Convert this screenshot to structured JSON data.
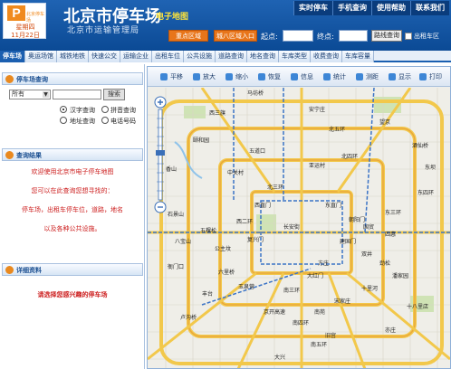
{
  "header": {
    "logo_text": "P",
    "logo_sub": "北京停车场",
    "weekday": "星期四",
    "date": "11月22日",
    "title": "北京市停车场",
    "title_badge": "电子地图",
    "subtitle": "北京市运输管理局",
    "top_nav": [
      "实时停车",
      "手机查询",
      "使用帮助",
      "联系我们"
    ],
    "center_area_btn": "重点区域",
    "city_entry_btn": "城八区域入口",
    "start_label": "起点:",
    "end_label": "终点:",
    "route_btn": "路线查询",
    "show_parking_label": "出租车区"
  },
  "tabs": [
    "停车场",
    "奥运场馆",
    "城铁地铁",
    "快速公交",
    "运输企业",
    "出租车位",
    "公共设施",
    "道路查询",
    "地名查询",
    "车库类型",
    "收费查询",
    "车库容量"
  ],
  "active_tab": 0,
  "left": {
    "search_header": "停车场查询",
    "select_value": "所有",
    "search_btn": "搜索",
    "radio1": "汉字查询",
    "radio2": "拼音查询",
    "radio3": "地址查询",
    "radio4": "电话号码",
    "result_header": "查询结果",
    "welcome_lines": [
      "欢迎使用北京市电子停车地图",
      "您可以在此查询您想寻找的：",
      "停车场，出租车停车位，道路，地名",
      "以及各种公共设施。"
    ],
    "detail_header": "详细资料",
    "detail_msg": "请选择您感兴趣的停车场"
  },
  "map": {
    "tools": [
      "平移",
      "放大",
      "缩小",
      "恢复",
      "信息",
      "统计",
      "测距",
      "显示",
      "打印"
    ],
    "labels": [
      "马坊桥",
      "西三旗",
      "安宁庄",
      "北五环",
      "亚运村",
      "北四环",
      "中关村",
      "五道口",
      "北三环",
      "西直门",
      "东直门",
      "朝阳门",
      "复兴门",
      "建国门",
      "长安街",
      "西二环",
      "东三环",
      "东四环",
      "南三环",
      "南四环",
      "丰台",
      "京开高速",
      "南五环",
      "大兴",
      "望京",
      "酒仙桥",
      "东坝",
      "石景山",
      "八宝山",
      "五棵松",
      "公主坟",
      "六里桥",
      "玉泉营",
      "宋家庄",
      "十里河",
      "大红门",
      "方庄",
      "亦庄",
      "四惠",
      "国贸",
      "双井",
      "劲松",
      "潘家园",
      "十八里店",
      "旧宫",
      "南苑",
      "卢沟桥",
      "衙门口",
      "香山",
      "颐和园"
    ]
  },
  "colors": {
    "header_blue": "#1a5aa8",
    "accent_orange": "#e8751a",
    "tab_active": "#1b5fb0",
    "road_yellow": "#f2c84b",
    "road_orange": "#e9a33a",
    "metro_blue": "#3a73c6",
    "alert_red": "#cc1c1c"
  }
}
